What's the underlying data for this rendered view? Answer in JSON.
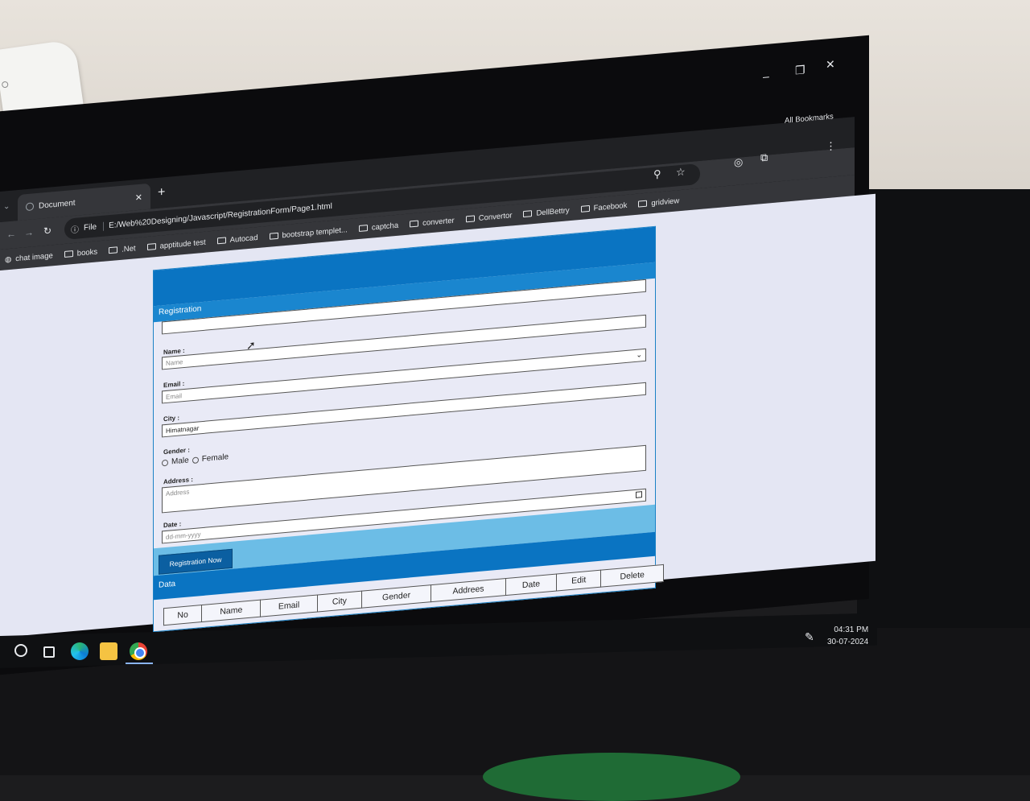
{
  "browser": {
    "tab_title": "Document",
    "url_scheme": "File",
    "url": "E:/Web%20Designing/Javascript/RegistrationForm/Page1.html",
    "all_bookmarks": "All Bookmarks",
    "bookmarks": [
      "chat image",
      "books",
      ".Net",
      "apptitude test",
      "Autocad",
      "bootstrap templet...",
      "captcha",
      "converter",
      "Convertor",
      "DellBettry",
      "Facebook",
      "gridview"
    ]
  },
  "form": {
    "section_title": "Registration",
    "name_label": "Name :",
    "name_placeholder": "Name",
    "email_label": "Email :",
    "email_placeholder": "Email",
    "city_label": "City :",
    "city_value": "Himatnagar",
    "gender_label": "Gender :",
    "gender_male": "Male",
    "gender_female": "Female",
    "address_label": "Address :",
    "address_placeholder": "Address",
    "date_label": "Date :",
    "date_placeholder": "dd-mm-yyyy",
    "submit_label": "Registration Now"
  },
  "data_section": {
    "title": "Data",
    "columns": [
      "No",
      "Name",
      "Email",
      "City",
      "Gender",
      "Addrees",
      "Date",
      "Edit",
      "Delete"
    ]
  },
  "taskbar": {
    "time": "04:31 PM",
    "date": "30-07-2024"
  },
  "icons": [
    "search-icon",
    "task-view-icon",
    "edge-icon",
    "file-explorer-icon",
    "chrome-icon",
    "pen-icon"
  ]
}
